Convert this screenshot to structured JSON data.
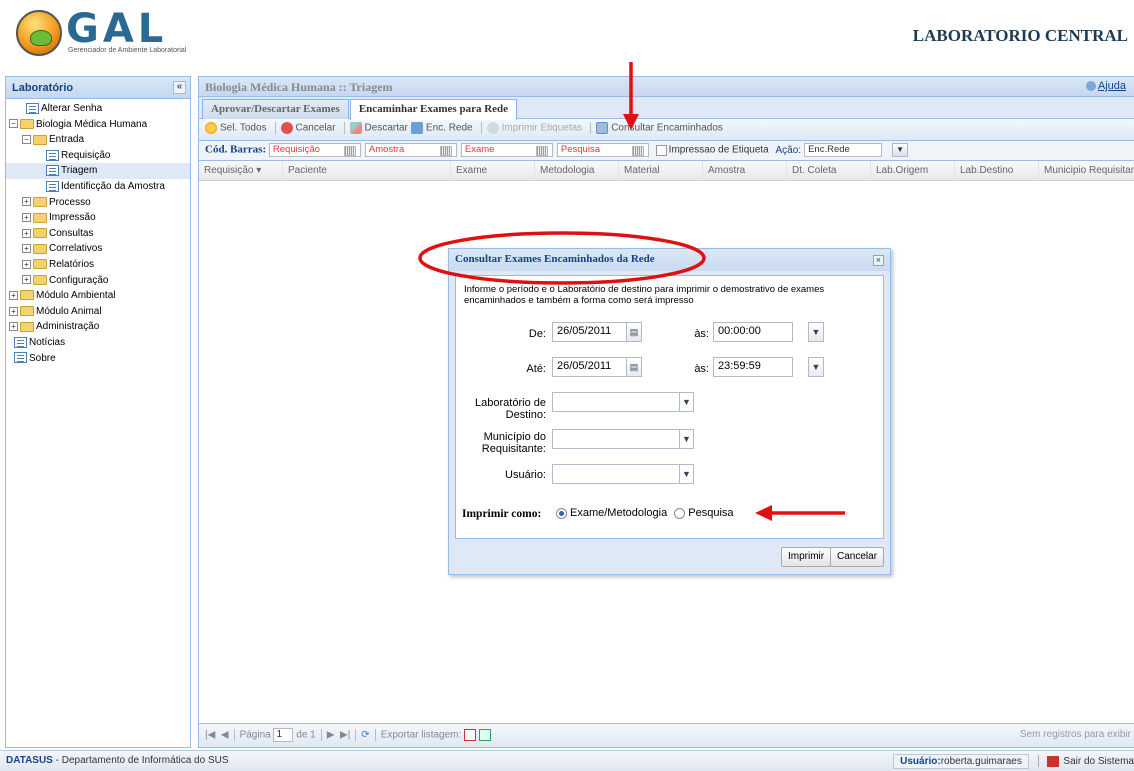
{
  "header": {
    "logo_text": "GAL",
    "logo_subtitle": "Gerenciador de Ambiente Laboratorial",
    "lab_title": "LABORATORIO CENTRAL"
  },
  "sidebar": {
    "title": "Laboratório",
    "collapse_glyph": "«",
    "items": [
      {
        "label": "Alterar Senha"
      },
      {
        "label": "Biologia Médica Humana"
      },
      {
        "label": "Entrada"
      },
      {
        "label": "Requisição"
      },
      {
        "label": "Triagem"
      },
      {
        "label": "Identificção da Amostra"
      },
      {
        "label": "Processo"
      },
      {
        "label": "Impressão"
      },
      {
        "label": "Consultas"
      },
      {
        "label": "Correlativos"
      },
      {
        "label": "Relatórios"
      },
      {
        "label": "Configuração"
      },
      {
        "label": "Módulo Ambiental"
      },
      {
        "label": "Módulo Animal"
      },
      {
        "label": "Administração"
      },
      {
        "label": "Notícias"
      },
      {
        "label": "Sobre"
      }
    ]
  },
  "main": {
    "title": "Biologia Médica Humana :: Triagem",
    "help_label": "Ajuda",
    "tabs": [
      {
        "label": "Aprovar/Descartar Exames"
      },
      {
        "label": "Encaminhar Exames para Rede"
      }
    ],
    "toolbar": {
      "select_all": "Sel. Todos",
      "cancel": "Cancelar",
      "discard": "Descartar",
      "forward": "Enc. Rede",
      "print_labels": "Imprimir Etiquetas",
      "consult": "Consultar Encaminhados"
    },
    "barcode": {
      "label": "Cód. Barras:",
      "fields": [
        "Requisição",
        "Amostra",
        "Exame",
        "Pesquisa"
      ],
      "print_label_check": "Impressao de Etiqueta",
      "action_label": "Ação:",
      "action_value": "Enc.Rede"
    },
    "columns": [
      "Requisição",
      "Paciente",
      "Exame",
      "Metodologia",
      "Material",
      "Amostra",
      "Dt. Coleta",
      "Lab.Origem",
      "Lab.Destino",
      "Municipio Requisitante"
    ],
    "pager": {
      "page_label": "Página",
      "page_value": "1",
      "of_label": "de 1",
      "export_label": "Exportar listagem:",
      "no_records": "Sem registros para exibir"
    }
  },
  "dialog": {
    "title": "Consultar Exames Encaminhados da Rede",
    "close_glyph": "×",
    "info": "Informe o período e o Laboratório de destino para imprimir o demostrativo de exames encaminhados e também a forma como será impresso",
    "from_label": "De:",
    "from_date": "26/05/2011",
    "from_time_label": "às:",
    "from_time": "00:00:00",
    "to_label": "Até:",
    "to_date": "26/05/2011",
    "to_time_label": "às:",
    "to_time": "23:59:59",
    "lab_label": "Laboratório de Destino:",
    "mun_label": "Município do Requisitante:",
    "user_label": "Usuário:",
    "print_as_label": "Imprimir como:",
    "radio_exam": "Exame/Metodologia",
    "radio_search": "Pesquisa",
    "print_button": "Imprimir",
    "cancel_button": "Cancelar"
  },
  "status": {
    "org_strong": "DATASUS",
    "org_rest": " - Departamento de Informática do SUS",
    "user_label": "Usuário:",
    "user_value": "roberta.guimaraes",
    "logout": "Sair do Sistema"
  },
  "colors": {
    "panel_header": "#dae7f6",
    "border": "#99bbe8",
    "annotation": "#e01010"
  }
}
